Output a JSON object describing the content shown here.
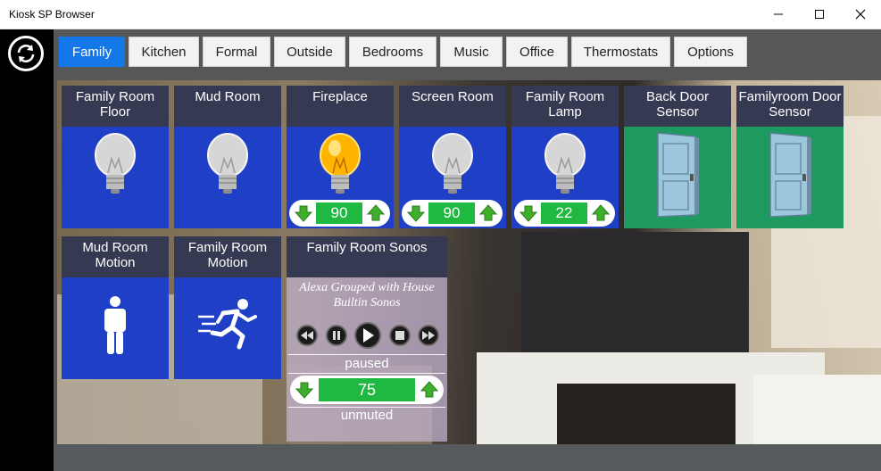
{
  "window": {
    "title": "Kiosk SP Browser"
  },
  "tabs": [
    {
      "label": "Family",
      "active": true
    },
    {
      "label": "Kitchen",
      "active": false
    },
    {
      "label": "Formal",
      "active": false
    },
    {
      "label": "Outside",
      "active": false
    },
    {
      "label": "Bedrooms",
      "active": false
    },
    {
      "label": "Music",
      "active": false
    },
    {
      "label": "Office",
      "active": false
    },
    {
      "label": "Thermostats",
      "active": false
    },
    {
      "label": "Options",
      "active": false
    }
  ],
  "tiles": {
    "family_room_floor": {
      "name": "Family Room Floor",
      "icon": "bulb-off-icon"
    },
    "mud_room": {
      "name": "Mud Room",
      "icon": "bulb-off-icon"
    },
    "fireplace": {
      "name": "Fireplace",
      "icon": "bulb-on-icon",
      "level": "90"
    },
    "screen_room": {
      "name": "Screen Room",
      "icon": "bulb-off-icon",
      "level": "90"
    },
    "family_room_lamp": {
      "name": "Family Room Lamp",
      "icon": "bulb-off-icon",
      "level": "22"
    },
    "back_door_sensor": {
      "name": "Back Door Sensor",
      "icon": "door-closed-icon"
    },
    "familyroom_door_sensor": {
      "name": "Familyroom Door Sensor",
      "icon": "door-closed-icon"
    },
    "mud_room_motion": {
      "name": "Mud Room Motion",
      "icon": "person-standing-icon"
    },
    "family_room_motion": {
      "name": "Family Room Motion",
      "icon": "person-running-icon"
    }
  },
  "sonos": {
    "name": "Family Room Sonos",
    "group": "Alexa Grouped with House Builtin Sonos",
    "state": "paused",
    "volume": "75",
    "mute": "unmuted"
  },
  "colors": {
    "tab_active": "#1478e8",
    "tile_header": "#353a52",
    "switch_body": "#1f3fc7",
    "contact_body": "#1e9960",
    "level_fill": "#1fb840"
  }
}
